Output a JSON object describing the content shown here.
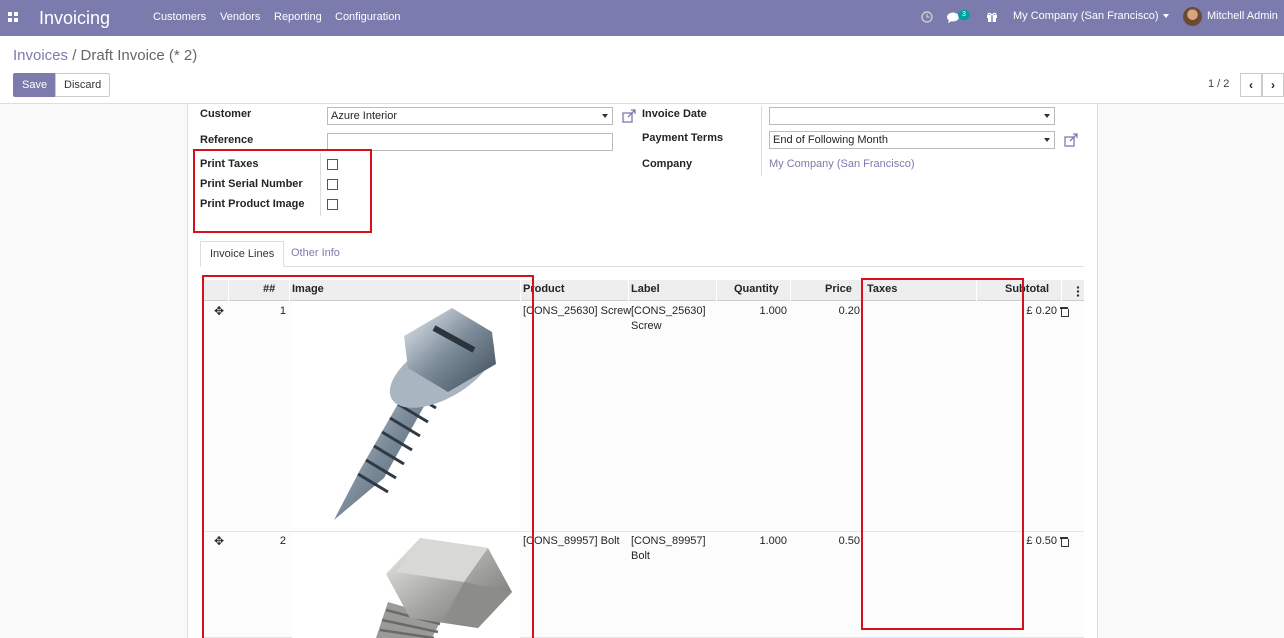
{
  "navbar": {
    "app_title": "Invoicing",
    "menu": [
      "Customers",
      "Vendors",
      "Reporting",
      "Configuration"
    ],
    "messages_count": "3",
    "company": "My Company (San Francisco)",
    "user": "Mitchell Admin",
    "color": "#7c7bad"
  },
  "breadcrumb": {
    "parent": "Invoices",
    "separator": "/",
    "current": "Draft Invoice (* 2)"
  },
  "buttons": {
    "save": "Save",
    "discard": "Discard"
  },
  "pager": {
    "text": "1 / 2"
  },
  "form": {
    "customer_label": "Customer",
    "customer_value": "Azure Interior",
    "reference_label": "Reference",
    "reference_value": "",
    "print_taxes_label": "Print Taxes",
    "print_serial_label": "Print Serial Number",
    "print_image_label": "Print Product Image",
    "invoice_date_label": "Invoice Date",
    "invoice_date_value": "",
    "payment_terms_label": "Payment Terms",
    "payment_terms_value": "End of Following Month",
    "company_label": "Company",
    "company_value": "My Company (San Francisco)"
  },
  "tabs": [
    "Invoice Lines",
    "Other Info"
  ],
  "table": {
    "headers": [
      "##",
      "Image",
      "Product",
      "Label",
      "Quantity",
      "Price",
      "Taxes",
      "Subtotal"
    ],
    "rows": [
      {
        "seq": "1",
        "product": "[CONS_25630] Screw",
        "label_line1": "[CONS_25630]",
        "label_line2": "Screw",
        "quantity": "1.000",
        "price": "0.20",
        "taxes": "",
        "subtotal": "£ 0.20",
        "image": "screw"
      },
      {
        "seq": "2",
        "product": "[CONS_89957] Bolt",
        "label_line1": "[CONS_89957]",
        "label_line2": "Bolt",
        "quantity": "1.000",
        "price": "0.50",
        "taxes": "",
        "subtotal": "£ 0.50",
        "image": "bolt"
      }
    ]
  },
  "highlight_color": "#d7101e"
}
